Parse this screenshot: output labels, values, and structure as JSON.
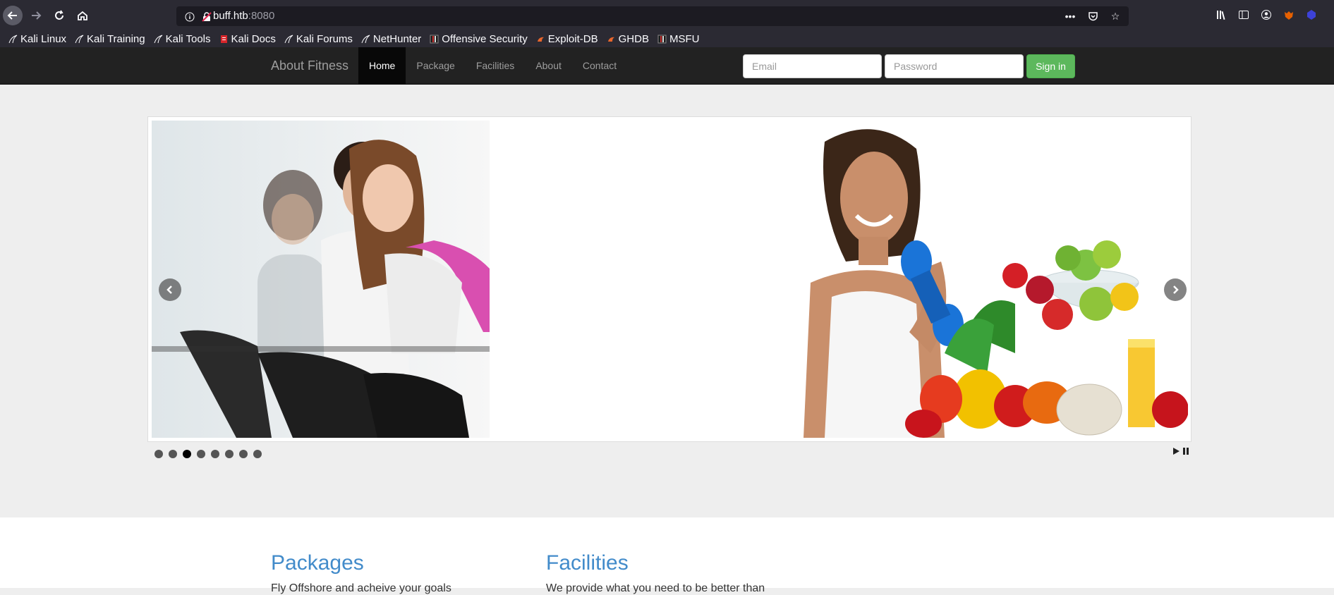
{
  "browser": {
    "url_host": "buff.htb",
    "url_port": ":8080",
    "nav": {
      "back_icon": "arrow-left-icon",
      "forward_icon": "arrow-right-icon",
      "reload_icon": "reload-icon",
      "home_icon": "home-icon"
    },
    "bookmarks": [
      {
        "label": "Kali Linux",
        "icon": "kali-dragon-icon"
      },
      {
        "label": "Kali Training",
        "icon": "kali-dragon-icon"
      },
      {
        "label": "Kali Tools",
        "icon": "kali-dragon-icon"
      },
      {
        "label": "Kali Docs",
        "icon": "kali-docs-icon"
      },
      {
        "label": "Kali Forums",
        "icon": "kali-dragon-icon"
      },
      {
        "label": "NetHunter",
        "icon": "kali-dragon-icon"
      },
      {
        "label": "Offensive Security",
        "icon": "offsec-icon"
      },
      {
        "label": "Exploit-DB",
        "icon": "exploitdb-icon"
      },
      {
        "label": "GHDB",
        "icon": "exploitdb-icon"
      },
      {
        "label": "MSFU",
        "icon": "offsec-icon"
      }
    ]
  },
  "site": {
    "brand": "About Fitness",
    "nav_items": [
      "Home",
      "Package",
      "Facilities",
      "About",
      "Contact"
    ],
    "active_nav": "Home",
    "email_placeholder": "Email",
    "password_placeholder": "Password",
    "signin_label": "Sign in"
  },
  "slider": {
    "dot_count": 8,
    "active_dot": 3,
    "prev_icon": "chevron-left-icon",
    "next_icon": "chevron-right-icon",
    "play_icon": "play-icon",
    "pause_icon": "pause-icon"
  },
  "content": {
    "packages_title": "Packages",
    "packages_text": "Fly Offshore and acheive your goals",
    "facilities_title": "Facilities",
    "facilities_text": "We provide what you need to be better than"
  },
  "colors": {
    "navbar_bg": "#222222",
    "signin_green": "#5cb85c",
    "heading_blue": "#428bca"
  }
}
